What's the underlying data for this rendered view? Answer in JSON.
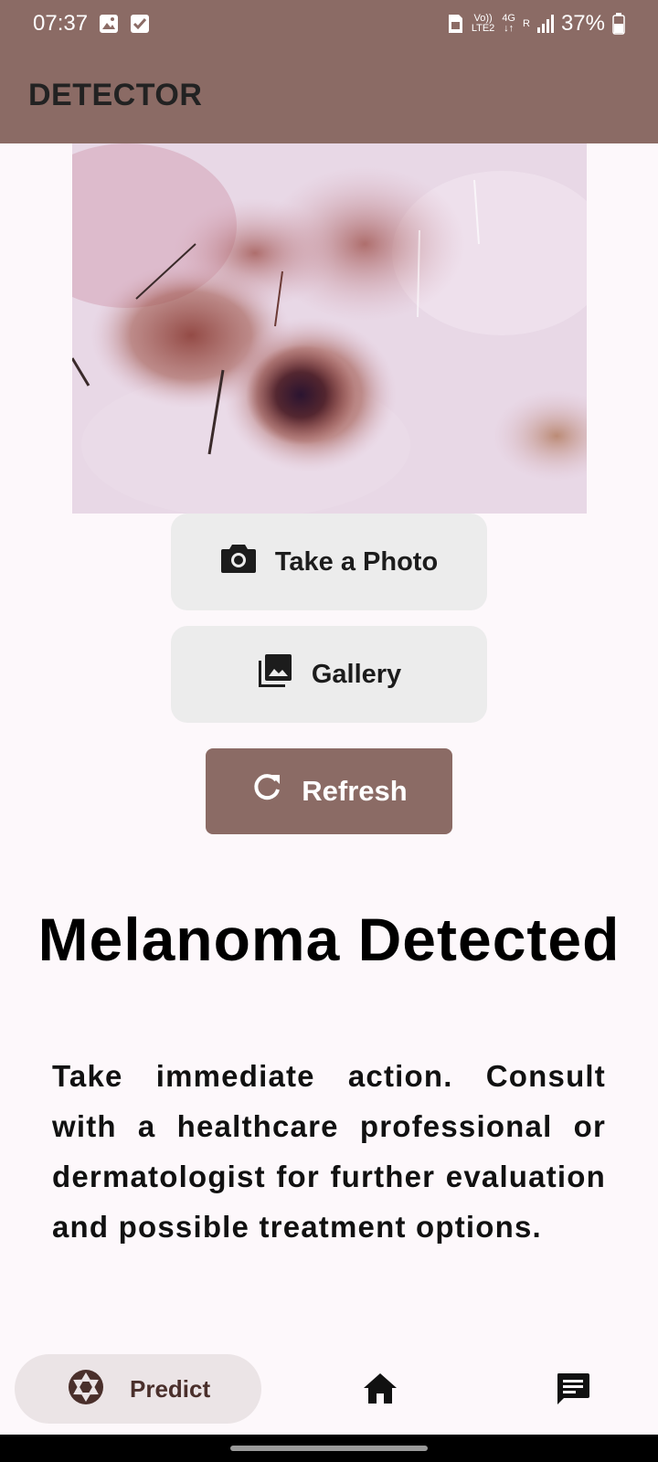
{
  "status_bar": {
    "time": "07:37",
    "network_top": "Vo))",
    "network_bottom": "LTE2",
    "network_type": "4G",
    "roaming": "R",
    "battery": "37%"
  },
  "app_bar": {
    "title": "DETECTOR"
  },
  "image": {
    "subject": "skin-lesion-photo"
  },
  "buttons": {
    "take_photo": "Take a Photo",
    "gallery": "Gallery",
    "refresh": "Refresh"
  },
  "result": {
    "title": "Melanoma Detected",
    "description": "Take immediate action. Consult with a healthcare professional or dermatologist for further evaluation and possible treatment options."
  },
  "bottom_nav": {
    "predict_label": "Predict",
    "items": [
      "predict",
      "home",
      "chat"
    ]
  },
  "colors": {
    "brand": "#8b6b65",
    "button_bg": "#ececec",
    "background": "#fdf8fb"
  }
}
